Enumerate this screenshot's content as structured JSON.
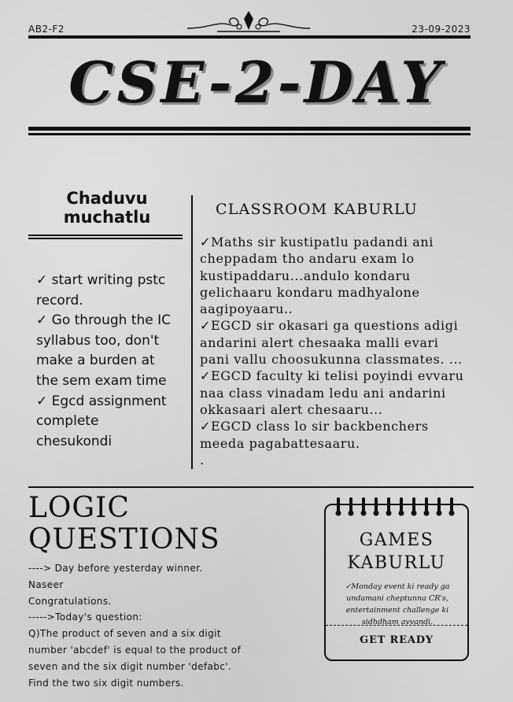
{
  "header": {
    "code": "AB2-F2",
    "date": "23-09-2023",
    "masthead": "CSE-2-DAY"
  },
  "left_column": {
    "title_lines": [
      "Chaduvu",
      "muchatlu"
    ],
    "items": [
      "✓ start writing pstc",
      "record.",
      "✓ Go through the IC",
      "syllabus too, don't",
      "make a burden at",
      "the sem exam time",
      "✓ Egcd assignment",
      "complete",
      "chesukondi"
    ]
  },
  "classroom": {
    "title": "CLASSROOM KABURLU",
    "lines": [
      "✓Maths sir kustipatlu padandi ani",
      "cheppadam tho andaru exam lo",
      "kustipaddaru...andulo kondaru",
      "gelichaaru kondaru madhyalone",
      "aagipoyaaru..",
      "✓EGCD sir okasari ga questions adigi",
      "andarini alert chesaaka malli evari",
      "pani vallu choosukunna classmates. ...",
      "✓EGCD faculty ki telisi poyindi evvaru",
      "naa class vinadam ledu ani  andarini",
      "okkasaari alert chesaaru...",
      "✓EGCD class lo sir backbenchers",
      "meeda pagabattesaaru.",
      "."
    ]
  },
  "logic": {
    "title_lines": [
      "LOGIC",
      "QUESTIONS"
    ],
    "lines": [
      "----> Day before yesterday winner.",
      "Naseer",
      "Congratulations.",
      "----->Today's question:",
      "Q)The product of seven and a six digit",
      "number 'abcdef' is equal to the product of",
      "seven and the six digit number 'defabc'.",
      "Find the two six digit numbers."
    ]
  },
  "games": {
    "title_lines": [
      "GAMES",
      "KABURLU"
    ],
    "body_lines": [
      "✓Monday event ki ready ga",
      "undamani cheptunna CR's,",
      "entertainment challenge ki",
      "sidhdham avvandi."
    ],
    "footer": "GET READY"
  }
}
